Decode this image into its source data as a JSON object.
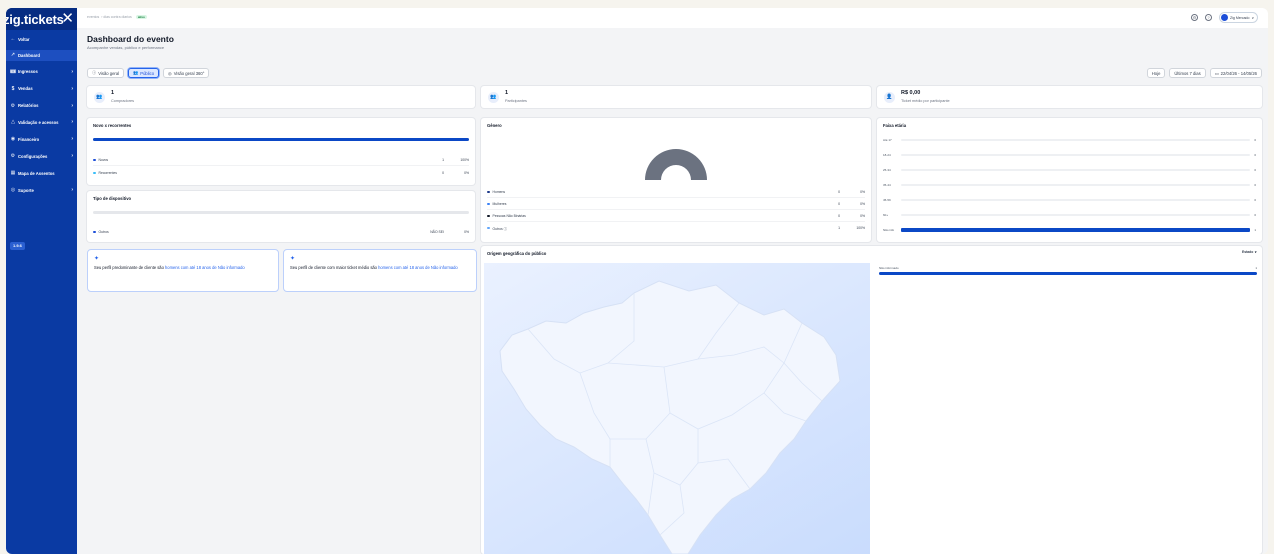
{
  "sidebar": {
    "brand": "zig.tickets",
    "items": [
      {
        "icon": "←",
        "label": "Voltar",
        "chevron": ""
      },
      {
        "icon": "↗",
        "label": "Dashboard",
        "chevron": ""
      },
      {
        "icon": "🎟",
        "label": "Ingressos",
        "chevron": "›"
      },
      {
        "icon": "$",
        "label": "Vendas",
        "chevron": "›"
      },
      {
        "icon": "⚙",
        "label": "Relatórios",
        "chevron": "›"
      },
      {
        "icon": "△",
        "label": "Validação e acessos",
        "chevron": "›"
      },
      {
        "icon": "◉",
        "label": "Financeiro",
        "chevron": "›"
      },
      {
        "icon": "⚙",
        "label": "Configurações",
        "chevron": "›"
      },
      {
        "icon": "▦",
        "label": "Mapa de Assentos",
        "chevron": ""
      },
      {
        "icon": "◎",
        "label": "Suporte",
        "chevron": "›"
      }
    ],
    "version": "1.9.6"
  },
  "topbar": {
    "crumb_a": "eventos",
    "crumb_b": "› dias contra diarios",
    "crumb_status": "ativo",
    "user_name": "Zig Mercado"
  },
  "header": {
    "title": "Dashboard do evento",
    "subtitle": "Acompanhe vendas, público e performance"
  },
  "views": [
    "Visão geral",
    "Público",
    "Visão geral 360°"
  ],
  "views_icons": [
    "ⓘ",
    "👥",
    "◎"
  ],
  "range": [
    "Hoje",
    "Últimos 7 dias",
    "22/04/26 - 14/05/26"
  ],
  "kpis": [
    {
      "icon": "👥",
      "value": "1",
      "label": "Compradores"
    },
    {
      "icon": "👥",
      "value": "1",
      "label": "Participantes"
    },
    {
      "icon": "👤",
      "value": "R$ 0,00",
      "label": "Ticket médio por participante"
    }
  ],
  "colors": {
    "accent": "#0b48c6",
    "sidebar": "#0a3aa3",
    "donut": "#6b7280"
  },
  "novos": {
    "title": "Novo x recorrentes",
    "bar_fraction": 1.0,
    "rows": [
      {
        "label": "Novos",
        "num": "1",
        "pct": "100%",
        "color": "#1d4ed8"
      },
      {
        "label": "Recorrentes",
        "num": "0",
        "pct": "0%",
        "color": "#38bdf8"
      }
    ]
  },
  "dispositivo": {
    "title": "Tipo de dispositivo",
    "bar_fraction": 0,
    "rows": [
      {
        "label": "Outros",
        "num": "NÃO SEI",
        "pct": "0%",
        "color": "#1d4ed8"
      }
    ]
  },
  "genero": {
    "title": "Gênero",
    "rows": [
      {
        "label": "Homens",
        "num": "0",
        "pct": "0%",
        "color": "#1e3a8a"
      },
      {
        "label": "Mulheres",
        "num": "0",
        "pct": "0%",
        "color": "#3b82f6"
      },
      {
        "label": "Pessoas Não Binárias",
        "num": "0",
        "pct": "0%",
        "color": "#111827"
      },
      {
        "label": "Outros ⓘ",
        "num": "1",
        "pct": "100%",
        "color": "#60a5fa"
      }
    ]
  },
  "faixa": {
    "title": "Faixa etária",
    "rows": [
      {
        "label": "Até 17",
        "value": "0",
        "fraction": 0
      },
      {
        "label": "18-24",
        "value": "0",
        "fraction": 0
      },
      {
        "label": "25-34",
        "value": "0",
        "fraction": 0
      },
      {
        "label": "35-44",
        "value": "0",
        "fraction": 0
      },
      {
        "label": "45-59",
        "value": "0",
        "fraction": 0
      },
      {
        "label": "60+",
        "value": "0",
        "fraction": 0
      },
      {
        "label": "Não info",
        "value": "1",
        "fraction": 1
      }
    ]
  },
  "insights": [
    {
      "pre": "Seu perfil predominante de cliente são ",
      "hl": "homens com até 18 anos de Não informado"
    },
    {
      "pre": "Seu perfil de cliente com maior ticket médio são ",
      "hl": "homens com até 18 anos de Não informado"
    }
  ],
  "origem": {
    "title": "Origem geográfica do público",
    "sort": "Estado ∨",
    "rows": [
      {
        "label": "Não informado",
        "value": "1",
        "fraction": 1
      }
    ]
  }
}
